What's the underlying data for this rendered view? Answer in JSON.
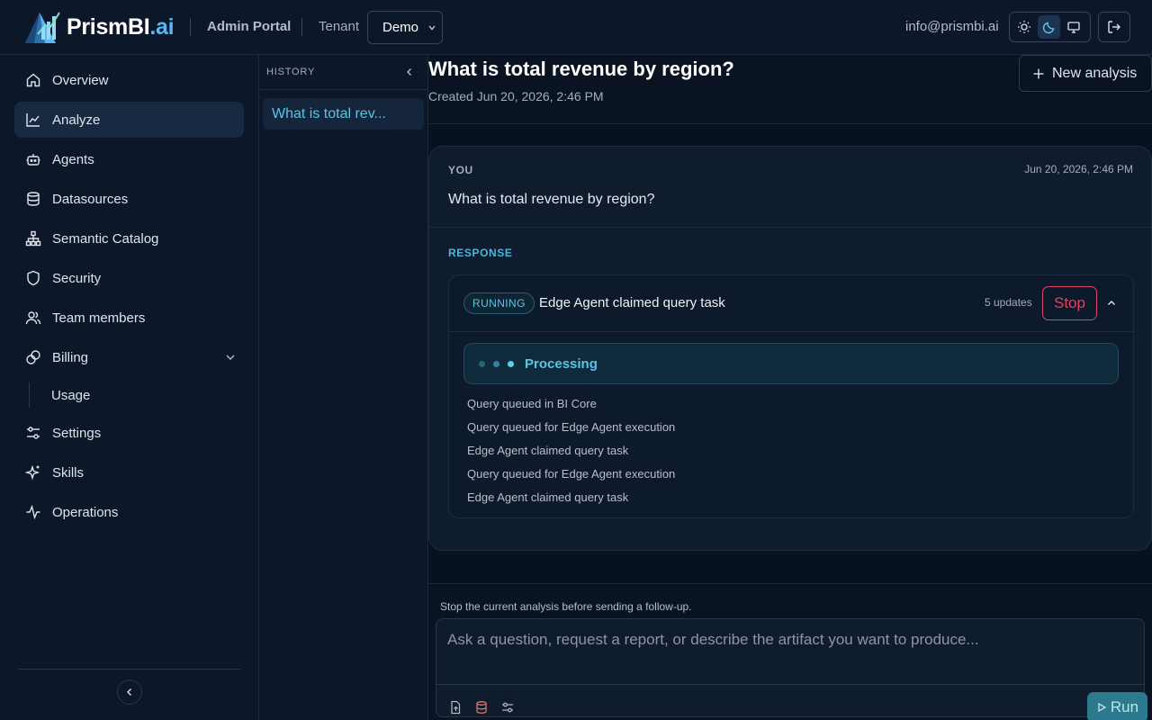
{
  "header": {
    "logo_text": "PrismBI",
    "logo_suffix": ".ai",
    "portal_label": "Admin Portal",
    "tenant_label": "Tenant",
    "tenant_value": "Demo",
    "user_email": "info@prismbi.ai"
  },
  "sidebar": {
    "items": [
      {
        "label": "Overview",
        "icon": "home-icon"
      },
      {
        "label": "Analyze",
        "icon": "chart-line-icon",
        "active": true
      },
      {
        "label": "Agents",
        "icon": "bot-icon"
      },
      {
        "label": "Datasources",
        "icon": "database-icon"
      },
      {
        "label": "Semantic Catalog",
        "icon": "hierarchy-icon"
      },
      {
        "label": "Security",
        "icon": "shield-icon"
      },
      {
        "label": "Team members",
        "icon": "users-icon"
      },
      {
        "label": "Billing",
        "icon": "billing-link-icon",
        "expanded": true
      },
      {
        "label": "Settings",
        "icon": "sliders-icon"
      },
      {
        "label": "Skills",
        "icon": "sparkles-icon"
      },
      {
        "label": "Operations",
        "icon": "activity-icon"
      }
    ],
    "billing_sub": [
      "Usage"
    ]
  },
  "history": {
    "title": "HISTORY",
    "items": [
      "What is total rev..."
    ]
  },
  "analysis": {
    "title": "What is total revenue by region?",
    "created": "Created Jun 20, 2026, 2:46 PM",
    "new_button": "New analysis"
  },
  "message": {
    "role": "YOU",
    "time": "Jun 20, 2026, 2:46 PM",
    "text": "What is total revenue by region?"
  },
  "response": {
    "label": "RESPONSE",
    "status": "RUNNING",
    "title": "Edge Agent claimed query task",
    "updates": "5 updates",
    "stop_label": "Stop",
    "processing": "Processing",
    "log": [
      "Query queued in BI Core",
      "Query queued for Edge Agent execution",
      "Edge Agent claimed query task",
      "Query queued for Edge Agent execution",
      "Edge Agent claimed query task"
    ]
  },
  "composer": {
    "note": "Stop the current analysis before sending a follow-up.",
    "placeholder": "Ask a question, request a report, or describe the artifact you want to produce...",
    "run_label": "Run"
  },
  "colors": {
    "accent": "#5bc5e4",
    "stop": "#e0415f",
    "background": "#0a1322"
  }
}
